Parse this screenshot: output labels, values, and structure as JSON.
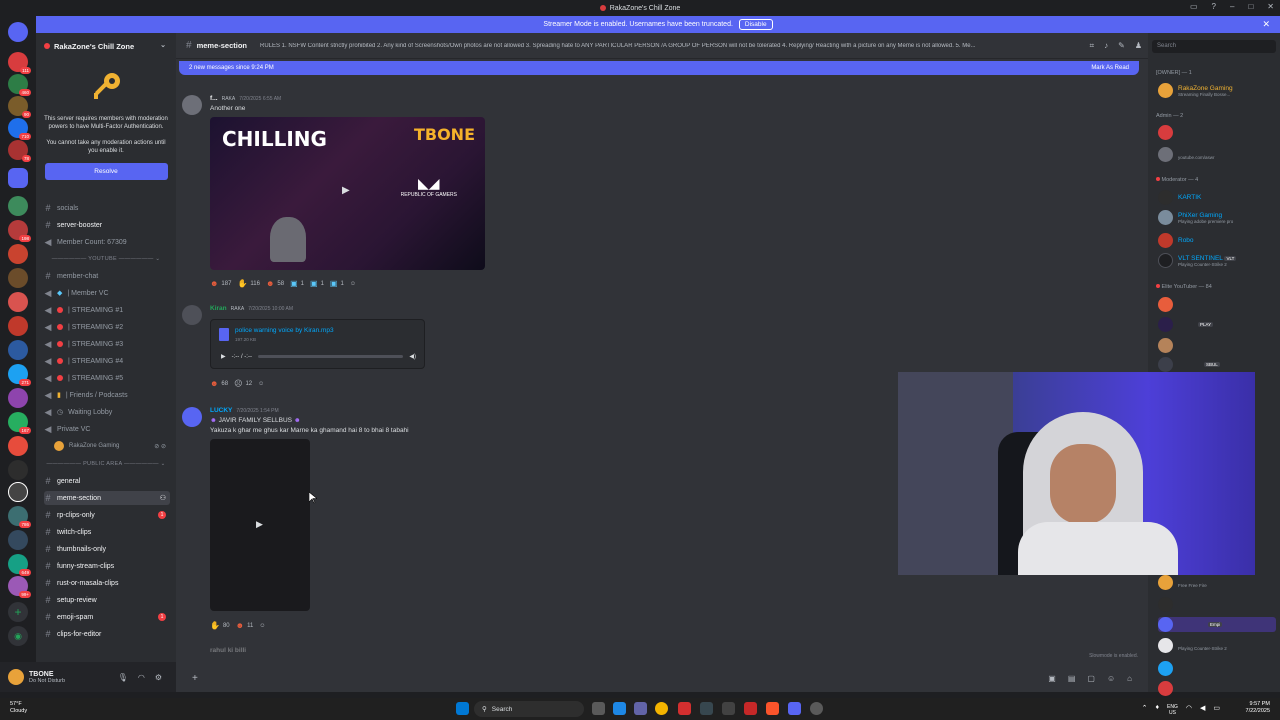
{
  "window": {
    "title": "RakaZone's Chill Zone"
  },
  "streamer_bar": {
    "text": "Streamer Mode is enabled. Usernames have been truncated.",
    "button": "Disable"
  },
  "server": {
    "name": "RakaZone's Chill Zone"
  },
  "mfa": {
    "text1": "This server requires members with moderation powers to have Multi-Factor Authentication.",
    "text2": "You cannot take any moderation actions until you enable it.",
    "resolve": "Resolve"
  },
  "channels": {
    "socials": "socials",
    "server_booster": "server-booster",
    "member_count": "Member Count: 67309",
    "cat_youtube": "YOUTUBE",
    "member_chat": "member-chat",
    "member_vc": "| Member VC",
    "streaming1": "| STREAMING #1",
    "streaming2": "| STREAMING #2",
    "streaming3": "| STREAMING #3",
    "streaming4": "| STREAMING #4",
    "streaming5": "| STREAMING #5",
    "friends": "| Friends / Podcasts",
    "waiting": "Waiting Lobby",
    "private_vc": "Private VC",
    "vc_user": "RakaZone Gaming",
    "cat_public": "PUBLIC AREA",
    "general": "general",
    "meme_section": "meme-section",
    "rp_clips": "rp-clips-only",
    "twitch_clips": "twitch-clips",
    "thumbnails": "thumbnails-only",
    "funny_stream": "funny-stream-clips",
    "rust_masala": "rust-or-masala-clips",
    "setup_review": "setup-review",
    "emoji_spam": "emoji-spam",
    "clips_editor": "clips-for-editor"
  },
  "user_panel": {
    "name": "TBONE",
    "status": "Do Not Disturb"
  },
  "header": {
    "channel": "meme-section",
    "topic": "RULES 1. NSFW Content strictly prohibited 2. Any kind of Screenshots/Own photos are not allowed 3. Spreading hate to ANY PARTICULAR PERSON /A GROUP OF PERSON will not be tolerated 4. Replying/ Reacting with a picture on any Meme is not allowed. 5. Me..."
  },
  "new_messages": {
    "text": "2 new messages since 9:24 PM",
    "mark": "Mark As Read"
  },
  "messages": [
    {
      "author": "f...",
      "tag": "RAKA",
      "time": "7/20/2025 6:55 AM",
      "text": "Another one",
      "video_title": "CHILLING",
      "video_brand": "TBONE",
      "video_sub": "REPUBLIC OF GAMERS",
      "reactions": [
        "187",
        "116",
        "58",
        "1",
        "1",
        "1"
      ]
    },
    {
      "author": "Kiran",
      "tag": "RAKA",
      "time": "7/20/2025 10:00 AM",
      "file": "police warning voice by Kiran.mp3",
      "size": "197.20 KB",
      "duration": "-:-- / -:--",
      "reactions": [
        "68",
        "12"
      ]
    },
    {
      "author": "LUCKY",
      "time": "7/20/2025 1:54 PM",
      "line1": "JAVIR FAMILY SELLBUS",
      "line2": "Yakuza k ghar me ghus kar Marne ka ghamand hai 8 to bhai 8 tabahi",
      "reactions": [
        "80",
        "11"
      ]
    }
  ],
  "next_author": "rahul ki billi",
  "slowmode": "Slowmode is enabled.",
  "members": {
    "search": "Search",
    "owner_group": "[OWNER] — 1",
    "owner_name": "RakaZone Gaming",
    "owner_status": "Streaming Finally Bosse...",
    "admin_group": "Admin — 2",
    "admin2_status": "youtube.com/aswr",
    "mod_group": "Moderator — 4",
    "mod1": "KARTIK",
    "mod2": "PhiXer Gaming",
    "mod2_status": "Playing adobe premiere pro",
    "mod3": "Robo",
    "mod4": "VLT SENTINEL",
    "mod4_tag": "VLT",
    "mod4_status": "Playing Counter-Strike 2",
    "elite_group": "Elite YouTuber — 84",
    "elite_tag1": "PLAY",
    "elite_tag2": "SBUL",
    "low1_status": "Free Free Fire",
    "low_tag": "Empi",
    "low2_status": "Playing Counter-Strike 2"
  },
  "taskbar": {
    "weather_temp": "57°F",
    "weather_text": "Cloudy",
    "search": "Search",
    "lang1": "ENG",
    "lang2": "US",
    "time": "9:57 PM",
    "date": "7/22/2025"
  },
  "colors": {
    "accent": "#5865f2",
    "dnd": "#f23f43",
    "owner": "#f0b232"
  }
}
